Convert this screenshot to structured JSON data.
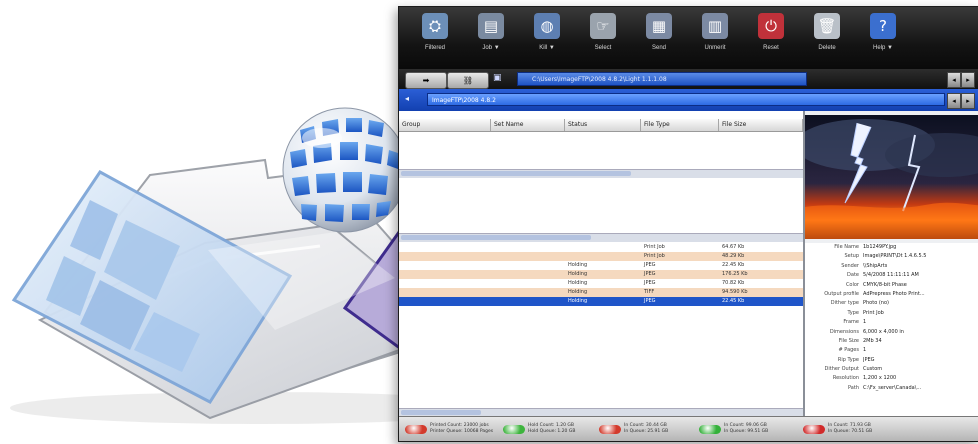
{
  "toolbar": {
    "buttons": [
      {
        "label": "Filtered",
        "icon": "filter-icon",
        "color": "#6c8fb8"
      },
      {
        "label": "Job ▼",
        "icon": "job-icon",
        "color": "#7a8aa0"
      },
      {
        "label": "Kill ▼",
        "icon": "globe-icon",
        "color": "#5d7fb2"
      },
      {
        "label": "Select",
        "icon": "select-icon",
        "color": "#9aa3ad"
      },
      {
        "label": "Send",
        "icon": "send-icon",
        "color": "#7c8aa3"
      },
      {
        "label": "Unmerit",
        "icon": "unmerit-icon",
        "color": "#7c8aa3"
      },
      {
        "label": "Reset",
        "icon": "reset-icon",
        "color": "#c0313a"
      },
      {
        "label": "Delete",
        "icon": "delete-icon",
        "color": "#b9c0c8"
      },
      {
        "label": "Help ▼",
        "icon": "help-icon",
        "color": "#3b6fcf"
      }
    ]
  },
  "tabs": {
    "path": "C:\\Users\\ImageFTP\\2008 4.8.2\\Light 1.1.1.08",
    "address": "ImageFTP\\2008 4.8.2"
  },
  "upper_grid": {
    "columns": [
      "Group",
      "Set Name",
      "Status",
      "File Type",
      "File Size"
    ]
  },
  "files": {
    "rows": [
      {
        "name": "",
        "status": "",
        "type": "Print Job",
        "size": "64.67 Kb",
        "style": "plain"
      },
      {
        "name": "",
        "status": "",
        "type": "Print Job",
        "size": "48.29 Kb",
        "style": "alt"
      },
      {
        "name": "",
        "status": "Holding",
        "type": "JPEG",
        "size": "22.45 Kb",
        "style": "plain"
      },
      {
        "name": "",
        "status": "Holding",
        "type": "JPEG",
        "size": "176.25 Kb",
        "style": "alt"
      },
      {
        "name": "",
        "status": "Holding",
        "type": "JPEG",
        "size": "70.82 Kb",
        "style": "plain"
      },
      {
        "name": "",
        "status": "Holding",
        "type": "TIFF",
        "size": "94.590 Kb",
        "style": "alt"
      },
      {
        "name": "",
        "status": "Holding",
        "type": "JPEG",
        "size": "22.45 Kb",
        "style": "sel"
      }
    ]
  },
  "info": {
    "rows": [
      {
        "k": "File Name",
        "v": "1b1249PY.jpg"
      },
      {
        "k": "Setup",
        "v": "Image\\PRINT\\Dt 1.4.6.5.5"
      },
      {
        "k": "Sender",
        "v": "\\\\ShipArts"
      },
      {
        "k": "Date",
        "v": "5/4/2008 11:11:11 AM"
      },
      {
        "k": "Color",
        "v": "CMYK/8-bit Phase"
      },
      {
        "k": "Output profile",
        "v": "AdPrepress Photo Print..."
      },
      {
        "k": "Dither type",
        "v": "Photo (no)"
      },
      {
        "k": "Type",
        "v": "Print Job"
      },
      {
        "k": "Frame",
        "v": "1"
      },
      {
        "k": "Dimensions",
        "v": "6,000 x 4,000 in"
      },
      {
        "k": "File Size",
        "v": "2Mb 34"
      },
      {
        "k": "# Pages",
        "v": "1"
      },
      {
        "k": "Rip Type",
        "v": "JPEG"
      },
      {
        "k": "Dither Output",
        "v": "Custom"
      },
      {
        "k": "Resolution",
        "v": "1,200 x 1200"
      },
      {
        "k": "Path",
        "v": "C:\\Fx_server\\Canada\\..."
      }
    ]
  },
  "status": {
    "groups": [
      {
        "line1": "Printed Count: 23000 jobs",
        "line2": "Printer Queue: 10068 Pages",
        "color": "#d33a2c"
      },
      {
        "line1": "Hold Count: 1.20 GB",
        "line2": "Hold Queue: 1.20 GB",
        "color": "#3db43d"
      },
      {
        "line1": "In Count: 30.44 GB",
        "line2": "In Queue: 25.91 GB",
        "color": "#d33a2c"
      },
      {
        "line1": "In Count: 99.06 GB",
        "line2": "In Queue: 99.51 GB",
        "color": "#34b13a"
      },
      {
        "line1": "In Count: 71.93 GB",
        "line2": "In Queue: 70.51 GB",
        "color": "#d12a2a"
      }
    ]
  }
}
